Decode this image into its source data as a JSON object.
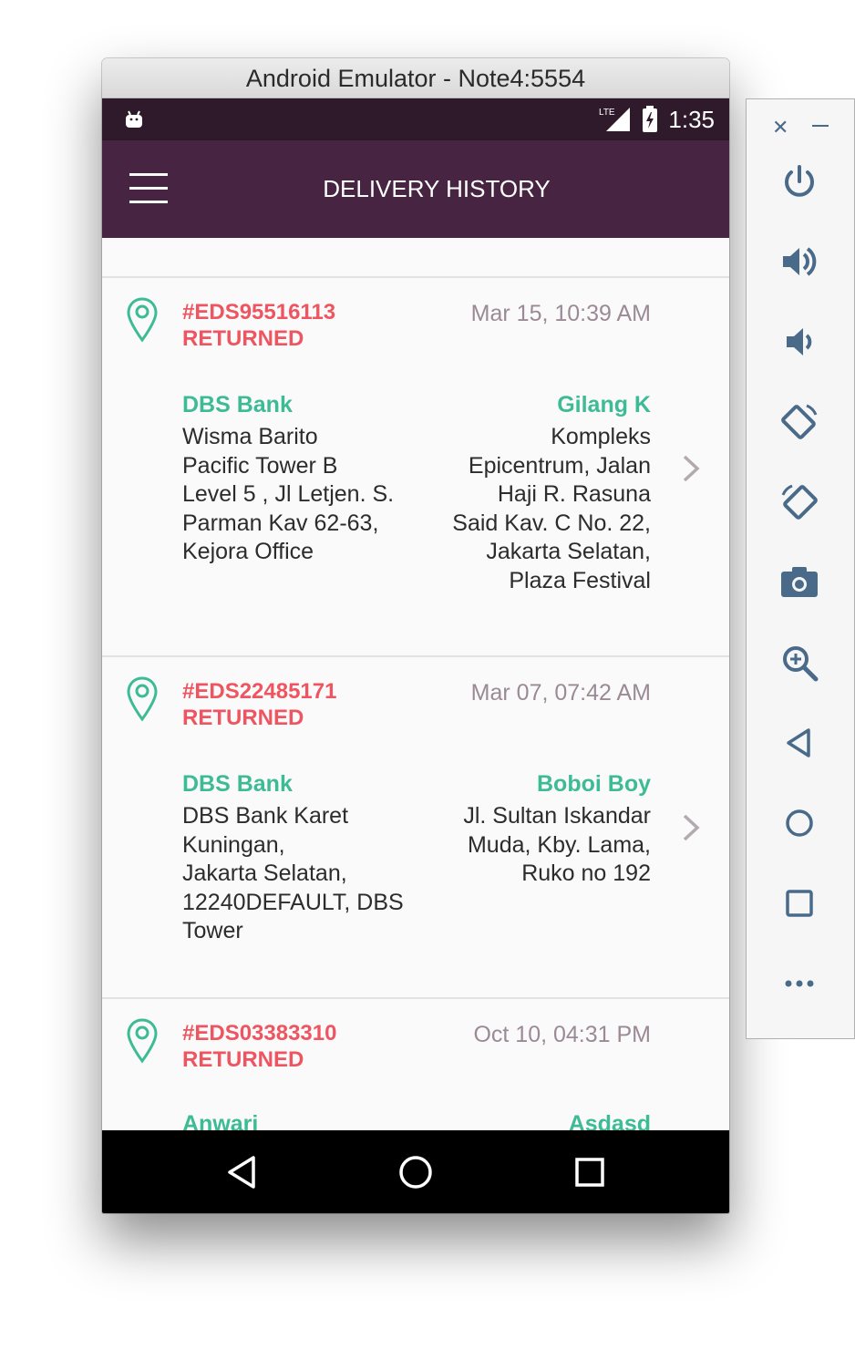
{
  "window": {
    "title": "Android Emulator - Note4:5554"
  },
  "statusbar": {
    "time": "1:35",
    "network": "LTE"
  },
  "appbar": {
    "title": "DELIVERY HISTORY"
  },
  "deliveries": [
    {
      "order_id": "#EDS95516113",
      "status": "RETURNED",
      "date": "Mar 15, 10:39 AM",
      "from_name": "DBS Bank",
      "from_address": [
        "Wisma Barito",
        "Pacific Tower B",
        "Level 5 , Jl Letjen. S.",
        "Parman Kav 62-63,",
        "Kejora Office"
      ],
      "to_name": "Gilang K",
      "to_address": [
        "Kompleks",
        "Epicentrum, Jalan",
        "Haji R. Rasuna",
        "Said Kav. C No. 22,",
        "Jakarta Selatan,",
        "Plaza Festival"
      ]
    },
    {
      "order_id": "#EDS22485171",
      "status": "RETURNED",
      "date": "Mar 07, 07:42 AM",
      "from_name": "DBS Bank",
      "from_address": [
        "DBS Bank Karet",
        "Kuningan,",
        "Jakarta Selatan,",
        "12240DEFAULT, DBS",
        "Tower"
      ],
      "to_name": "Boboi Boy",
      "to_address": [
        "Jl. Sultan Iskandar",
        "Muda, Kby. Lama,",
        "Ruko no 192"
      ]
    },
    {
      "order_id": "#EDS03383310",
      "status": "RETURNED",
      "date": "Oct 10, 04:31 PM",
      "from_name": "Anwari",
      "from_address": [],
      "to_name": "Asdasd",
      "to_address": []
    }
  ],
  "colors": {
    "statusbar": "#2f1a2b",
    "appbar": "#472441",
    "order_id": "#ef5561",
    "name": "#3dbb94",
    "date": "#9b8a96"
  },
  "icons": {
    "card": [
      "map-pin-icon",
      "chevron-right-icon"
    ],
    "navbar": [
      "back-icon",
      "home-icon",
      "recents-icon"
    ],
    "toolbar": [
      "close-icon",
      "minimize-icon",
      "power-icon",
      "volume-up-icon",
      "volume-down-icon",
      "rotate-left-icon",
      "rotate-right-icon",
      "camera-icon",
      "zoom-icon",
      "back-icon",
      "home-icon",
      "overview-icon",
      "more-icon"
    ]
  }
}
